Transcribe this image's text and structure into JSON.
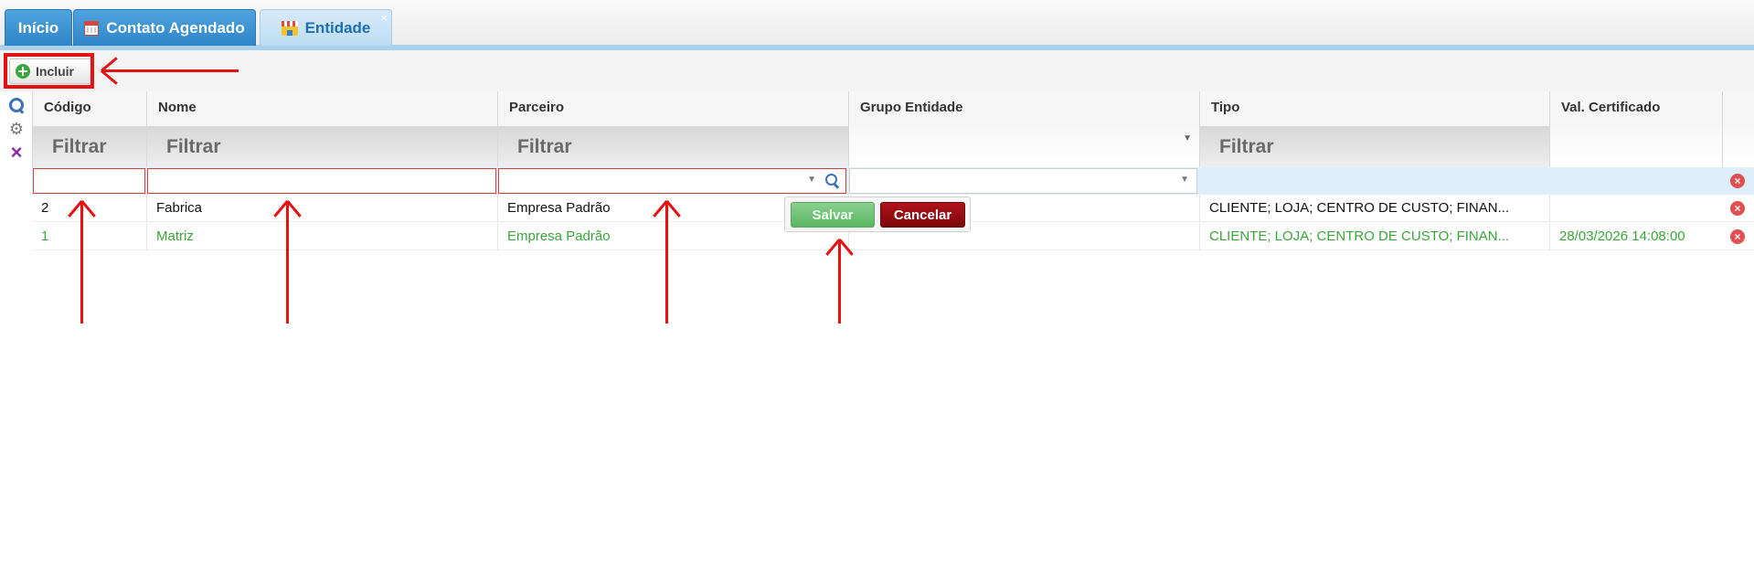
{
  "tabs": [
    {
      "label": "Início",
      "icon": ""
    },
    {
      "label": "Contato Agendado",
      "icon": "calendar-icon"
    },
    {
      "label": "Entidade",
      "icon": "store-icon",
      "close": "×"
    }
  ],
  "toolbar": {
    "add_label": "Incluir",
    "add_icon": "plus-circle-icon"
  },
  "side_icons": [
    "search-icon",
    "gear-icon",
    "clear-filter-icon"
  ],
  "columns": [
    "Código",
    "Nome",
    "Parceiro",
    "Grupo Entidade",
    "Tipo",
    "Val. Certificado"
  ],
  "filters": {
    "placeholder": "Filtrar"
  },
  "editor": {
    "save_label": "Salvar",
    "cancel_label": "Cancelar"
  },
  "rows": [
    {
      "codigo": "2",
      "nome": "Fabrica",
      "parceiro": "Empresa Padrão",
      "grupo": "",
      "tipo": "CLIENTE; LOJA; CENTRO DE CUSTO; FINAN...",
      "val_certificado": ""
    },
    {
      "codigo": "1",
      "nome": "Matriz",
      "parceiro": "Empresa Padrão",
      "grupo": "",
      "tipo": "CLIENTE; LOJA; CENTRO DE CUSTO; FINAN...",
      "val_certificado": "28/03/2026 14:08:00"
    }
  ],
  "colors": {
    "tab_blue": "#2f85c8",
    "active_tab": "#bddcf3",
    "edit_row": "#ddedf9",
    "annotation_red": "#e41212",
    "row_green": "#3aa53a",
    "save": "#5bb562",
    "cancel": "#7c070c"
  }
}
